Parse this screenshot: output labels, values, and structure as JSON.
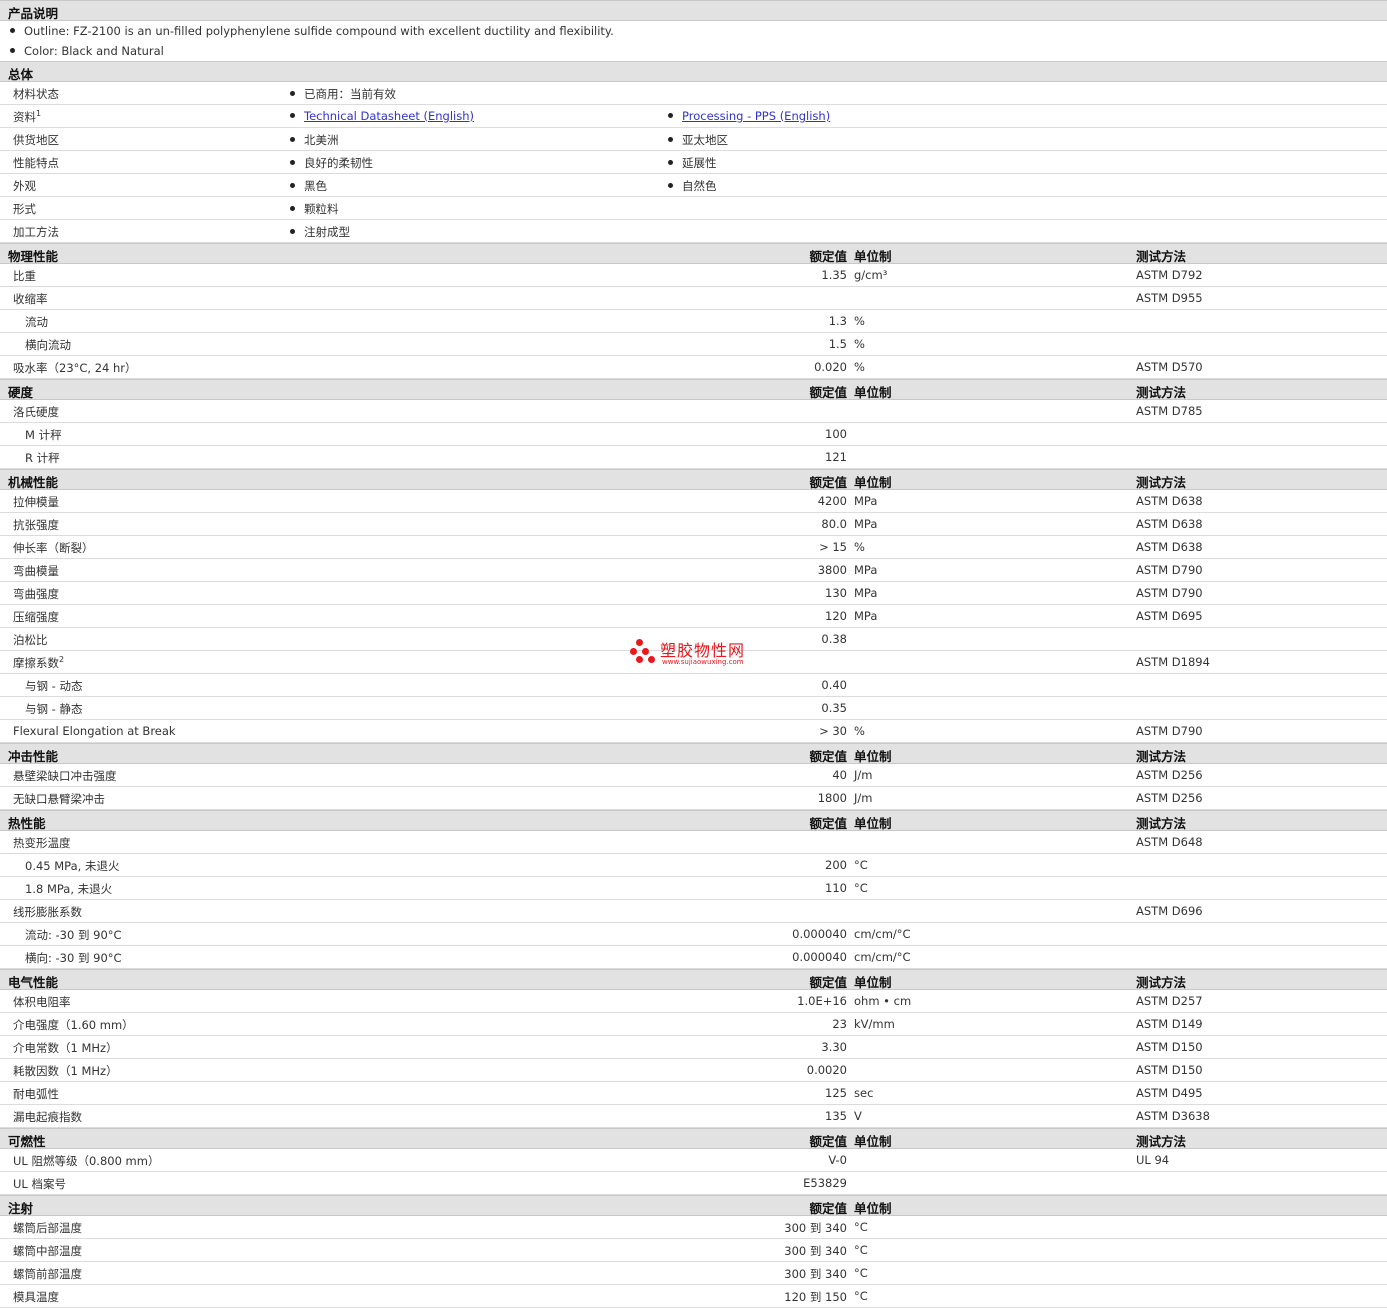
{
  "description": {
    "title": "产品说明",
    "items": [
      "Outline: FZ-2100 is an un-filled polyphenylene sulfide compound with excellent ductility and flexibility.",
      "Color: Black and Natural"
    ]
  },
  "general": {
    "title": "总体",
    "rows": [
      {
        "label": "材料状态",
        "c1": "已商用：当前有效",
        "c2": ""
      },
      {
        "label": "资料",
        "note": "1",
        "c1": "Technical Datasheet (English)",
        "c1_link": true,
        "c2": "Processing - PPS (English)",
        "c2_link": true
      },
      {
        "label": "供货地区",
        "c1": "北美洲",
        "c2": "亚太地区"
      },
      {
        "label": "性能特点",
        "c1": "良好的柔韧性",
        "c2": "延展性"
      },
      {
        "label": "外观",
        "c1": "黑色",
        "c2": "自然色"
      },
      {
        "label": "形式",
        "c1": "颗粒料",
        "c2": ""
      },
      {
        "label": "加工方法",
        "c1": "注射成型",
        "c2": ""
      }
    ]
  },
  "headers": {
    "value": "额定值",
    "unit": "单位制",
    "method": "测试方法"
  },
  "sections": [
    {
      "title": "物理性能",
      "show_method": true,
      "rows": [
        {
          "name": "比重",
          "value": "1.35",
          "unit": "g/cm³",
          "method": "ASTM D792"
        },
        {
          "name": "收缩率",
          "value": "",
          "unit": "",
          "method": "ASTM D955"
        },
        {
          "name": "流动",
          "sub": true,
          "value": "1.3",
          "unit": "%",
          "method": ""
        },
        {
          "name": "横向流动",
          "sub": true,
          "value": "1.5",
          "unit": "%",
          "method": ""
        },
        {
          "name": "吸水率（23°C, 24 hr）",
          "value": "0.020",
          "unit": "%",
          "method": "ASTM D570"
        }
      ]
    },
    {
      "title": "硬度",
      "show_method": true,
      "rows": [
        {
          "name": "洛氏硬度",
          "value": "",
          "unit": "",
          "method": "ASTM D785"
        },
        {
          "name": "M 计秤",
          "sub": true,
          "value": "100",
          "unit": "",
          "method": ""
        },
        {
          "name": "R 计秤",
          "sub": true,
          "value": "121",
          "unit": "",
          "method": ""
        }
      ]
    },
    {
      "title": "机械性能",
      "show_method": true,
      "rows": [
        {
          "name": "拉伸模量",
          "value": "4200",
          "unit": "MPa",
          "method": "ASTM D638"
        },
        {
          "name": "抗张强度",
          "value": "80.0",
          "unit": "MPa",
          "method": "ASTM D638"
        },
        {
          "name": "伸长率（断裂）",
          "value": "> 15",
          "unit": "%",
          "method": "ASTM D638"
        },
        {
          "name": "弯曲模量",
          "value": "3800",
          "unit": "MPa",
          "method": "ASTM D790"
        },
        {
          "name": "弯曲强度",
          "value": "130",
          "unit": "MPa",
          "method": "ASTM D790"
        },
        {
          "name": "压缩强度",
          "value": "120",
          "unit": "MPa",
          "method": "ASTM D695"
        },
        {
          "name": "泊松比",
          "value": "0.38",
          "unit": "",
          "method": ""
        },
        {
          "name": "摩擦系数",
          "note": "2",
          "value": "",
          "unit": "",
          "method": "ASTM D1894"
        },
        {
          "name": "与钢 - 动态",
          "sub": true,
          "value": "0.40",
          "unit": "",
          "method": ""
        },
        {
          "name": "与钢 - 静态",
          "sub": true,
          "value": "0.35",
          "unit": "",
          "method": ""
        },
        {
          "name": "Flexural Elongation at Break",
          "value": "> 30",
          "unit": "%",
          "method": "ASTM D790"
        }
      ]
    },
    {
      "title": "冲击性能",
      "show_method": true,
      "rows": [
        {
          "name": "悬壁梁缺口冲击强度",
          "value": "40",
          "unit": "J/m",
          "method": "ASTM D256"
        },
        {
          "name": "无缺口悬臂梁冲击",
          "value": "1800",
          "unit": "J/m",
          "method": "ASTM D256"
        }
      ]
    },
    {
      "title": "热性能",
      "show_method": true,
      "rows": [
        {
          "name": "热变形温度",
          "value": "",
          "unit": "",
          "method": "ASTM D648"
        },
        {
          "name": "0.45 MPa, 未退火",
          "sub": true,
          "value": "200",
          "unit": "°C",
          "method": ""
        },
        {
          "name": "1.8 MPa, 未退火",
          "sub": true,
          "value": "110",
          "unit": "°C",
          "method": ""
        },
        {
          "name": "线形膨胀系数",
          "value": "",
          "unit": "",
          "method": "ASTM D696"
        },
        {
          "name": "流动: -30 到 90°C",
          "sub": true,
          "value": "0.000040",
          "unit": "cm/cm/°C",
          "method": ""
        },
        {
          "name": "横向: -30 到 90°C",
          "sub": true,
          "value": "0.000040",
          "unit": "cm/cm/°C",
          "method": ""
        }
      ]
    },
    {
      "title": "电气性能",
      "show_method": true,
      "rows": [
        {
          "name": "体积电阻率",
          "value": "1.0E+16",
          "unit": "ohm • cm",
          "method": "ASTM D257"
        },
        {
          "name": "介电强度（1.60 mm）",
          "value": "23",
          "unit": "kV/mm",
          "method": "ASTM D149"
        },
        {
          "name": "介电常数（1 MHz）",
          "value": "3.30",
          "unit": "",
          "method": "ASTM D150"
        },
        {
          "name": "耗散因数（1 MHz）",
          "value": "0.0020",
          "unit": "",
          "method": "ASTM D150"
        },
        {
          "name": "耐电弧性",
          "value": "125",
          "unit": "sec",
          "method": "ASTM D495"
        },
        {
          "name": "漏电起痕指数",
          "value": "135",
          "unit": "V",
          "method": "ASTM D3638"
        }
      ]
    },
    {
      "title": "可燃性",
      "show_method": true,
      "rows": [
        {
          "name": "UL 阻燃等级（0.800 mm）",
          "value": "V-0",
          "unit": "",
          "method": "UL 94"
        },
        {
          "name": "UL 档案号",
          "value": "E53829",
          "unit": "",
          "method": ""
        }
      ]
    },
    {
      "title": "注射",
      "show_method": false,
      "rows": [
        {
          "name": "螺筒后部温度",
          "value": "300 到 340",
          "unit": "°C",
          "method": ""
        },
        {
          "name": "螺筒中部温度",
          "value": "300 到 340",
          "unit": "°C",
          "method": ""
        },
        {
          "name": "螺筒前部温度",
          "value": "300 到 340",
          "unit": "°C",
          "method": ""
        },
        {
          "name": "模具温度",
          "value": "120 到 150",
          "unit": "°C",
          "method": ""
        }
      ]
    }
  ],
  "watermark": {
    "title": "塑胶物性网",
    "url": "www.sujiaowuxing.com"
  },
  "colors": {
    "header_bg": "#e2e2e2",
    "link": "#3333cc",
    "watermark": "#e8181e"
  }
}
